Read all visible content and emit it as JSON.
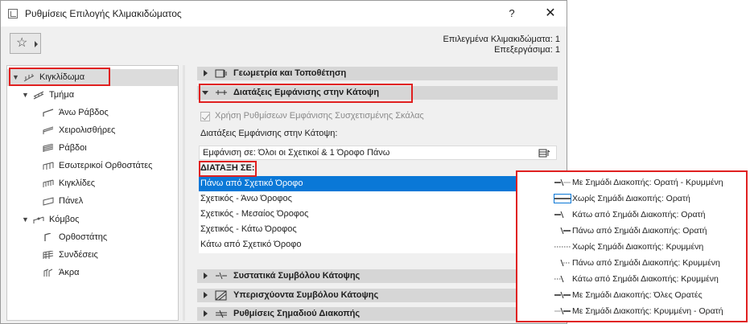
{
  "window": {
    "title": "Ρυθμίσεις Επιλογής Κλιμακιδώματος",
    "help": "?",
    "close": "✕"
  },
  "favorites": {
    "icon": "star-icon",
    "glyph": "☆"
  },
  "selection_info": {
    "line1": "Επιλεγμένα Κλιμακιδώματα: 1",
    "line2": "Επεξεργάσιμα: 1"
  },
  "tree": {
    "root": "Κιγκλίδωμα",
    "segment": "Τμήμα",
    "segment_children": [
      "Άνω Ράβδος",
      "Χειρολισθήρες",
      "Ράβδοι",
      "Εσωτερικοί Ορθοστάτες",
      "Κιγκλίδες",
      "Πάνελ"
    ],
    "node": "Κόμβος",
    "node_children": [
      "Ορθοστάτης",
      "Συνδέσεις",
      "Άκρα"
    ]
  },
  "panels": {
    "geometry": "Γεωμετρία και Τοποθέτηση",
    "floorplan_display": "Διατάξεις Εμφάνισης στην Κάτοψη",
    "components": "Συστατικά Συμβόλου Κάτοψης",
    "overhead": "Υπερισχύοντα Συμβόλου Κάτοψης",
    "breakmark": "Ρυθμίσεις Σημαδιού Διακοπής"
  },
  "floorplan": {
    "use_stair_settings": "Χρήση Ρυθμίσεων Εμφάνισης Συσχετισμένης Σκάλας",
    "section_label": "Διατάξεις Εμφάνισης στην Κάτοψη:",
    "show_on": "Εμφάνιση σε: Όλοι οι Σχετικοί & 1 Όροφο Πάνω",
    "order_label": "ΔΙΑΤΑΞΗ ΣΕ:",
    "rows": [
      "Πάνω από Σχετικό Όροφο",
      "Σχετικός - Άνω Όροφος",
      "Σχετικός - Μεσαίος Όροφος",
      "Σχετικός - Κάτω Όροφος",
      "Κάτω από Σχετικό Όροφο"
    ]
  },
  "popup": {
    "items": [
      "Με Σημάδι Διακοπής: Ορατή - Κρυμμένη",
      "Χωρίς Σημάδι Διακοπής: Ορατή",
      "Κάτω από Σημάδι Διακοπής: Ορατή",
      "Πάνω από Σημάδι Διακοπής: Ορατή",
      "Χωρίς Σημάδι Διακοπής: Κρυμμένη",
      "Πάνω από Σημάδι Διακοπής: Κρυμμένη",
      "Κάτω από Σημάδι Διακοπής: Κρυμμένη",
      "Με Σημάδι Διακοπής: Όλες Ορατές",
      "Με Σημάδι Διακοπής: Κρυμμένη - Ορατή"
    ]
  },
  "colors": {
    "highlight": "#e02020",
    "selection": "#0a78d7",
    "header": "#d6d6d6"
  }
}
